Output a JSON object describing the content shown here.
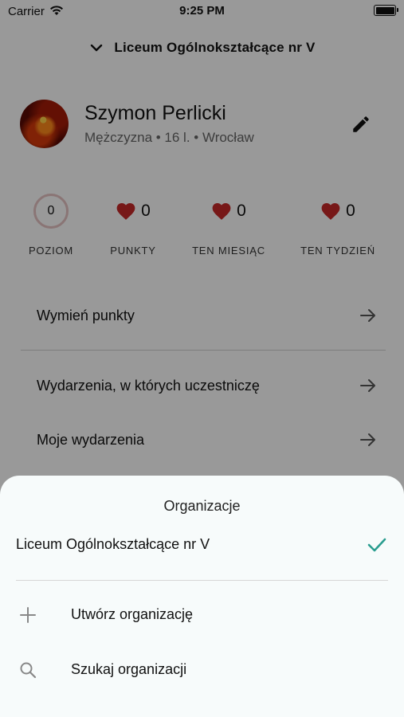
{
  "status_bar": {
    "carrier": "Carrier",
    "time": "9:25 PM"
  },
  "header": {
    "title": "Liceum Ogólnokształcące nr V"
  },
  "profile": {
    "name": "Szymon Perlicki",
    "meta": "Mężczyzna • 16 l. • Wrocław"
  },
  "stats": [
    {
      "value": "0",
      "label": "POZIOM"
    },
    {
      "value": "0",
      "label": "PUNKTY"
    },
    {
      "value": "0",
      "label": "TEN MIESIĄC"
    },
    {
      "value": "0",
      "label": "TEN TYDZIEŃ"
    }
  ],
  "menu": {
    "exchange_points": "Wymień punkty",
    "events_attending": "Wydarzenia, w których uczestniczę",
    "my_events": "Moje wydarzenia"
  },
  "sheet": {
    "title": "Organizacje",
    "selected_org": "Liceum Ogólnokształcące nr V",
    "create_org": "Utwórz organizację",
    "search_org": "Szukaj organizacji"
  },
  "colors": {
    "accent_check": "#2a9d8f",
    "heart": "#c62828",
    "overlay": "rgba(0,0,0,0.40)"
  },
  "icons": [
    "wifi-icon",
    "battery-icon",
    "chevron-down-icon",
    "edit-icon",
    "heart-icon",
    "arrow-right-icon",
    "check-icon",
    "plus-icon",
    "search-icon"
  ]
}
